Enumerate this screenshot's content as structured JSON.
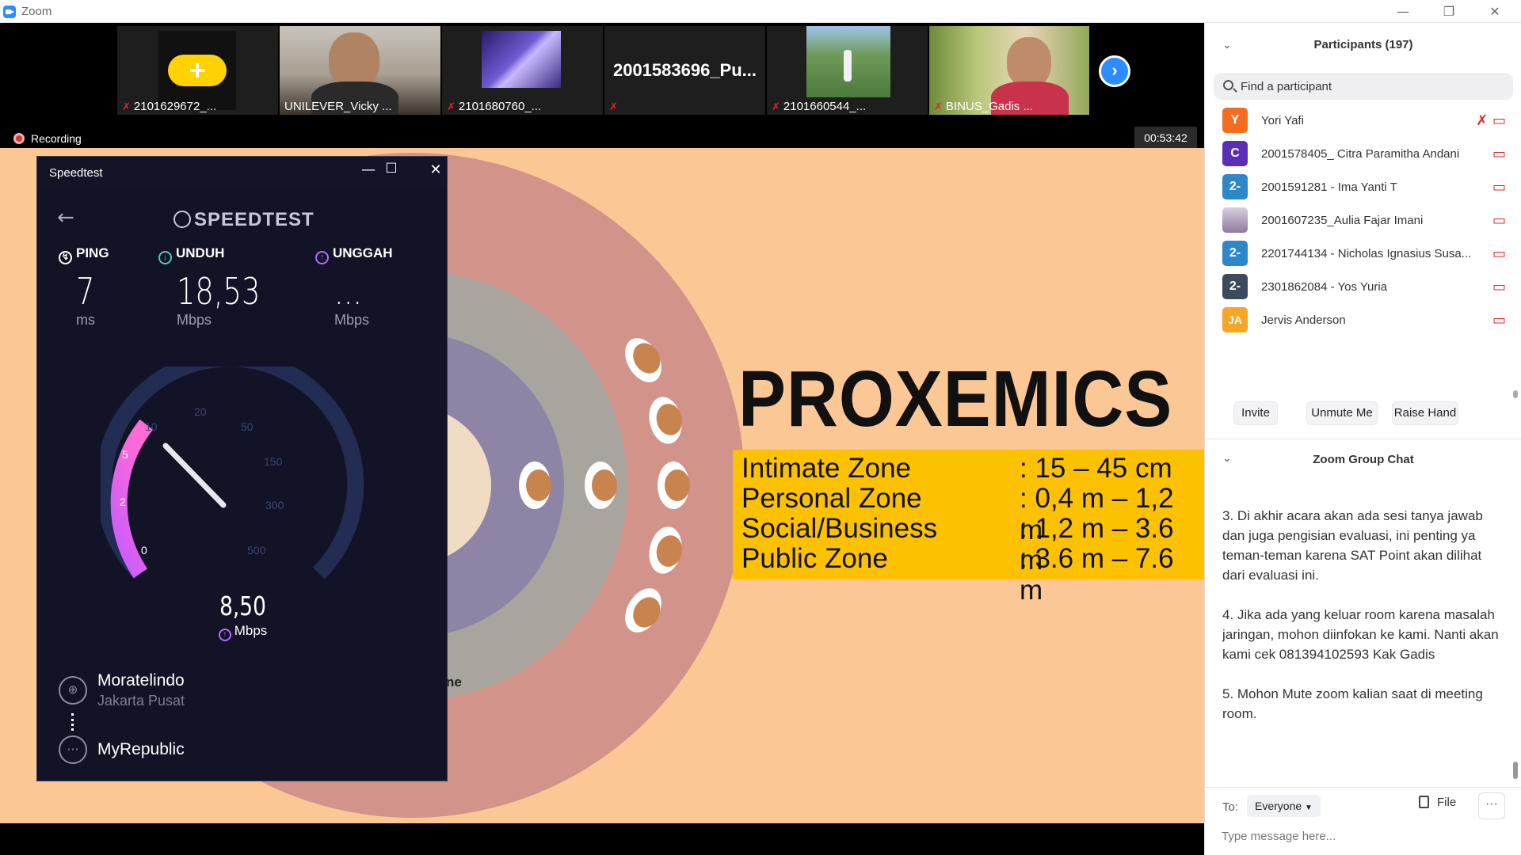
{
  "window": {
    "title": "Zoom",
    "min": "—",
    "restore": "❐",
    "close": "✕"
  },
  "thumbnails": [
    {
      "name": "2101629672_...",
      "muted": true,
      "avatar": "yellow-plus"
    },
    {
      "name": "UNILEVER_Vicky ...",
      "muted": false,
      "avatar": "video"
    },
    {
      "name": "2101680760_...",
      "muted": true,
      "avatar": "video"
    },
    {
      "name": "2001583696_Pu...",
      "muted": true,
      "avatar": "name"
    },
    {
      "name": "2101660544_...",
      "muted": true,
      "avatar": "video"
    },
    {
      "name": "BINUS_Gadis ...",
      "muted": true,
      "avatar": "video"
    }
  ],
  "recording": {
    "label": "Recording"
  },
  "timer": "00:53:42",
  "slide": {
    "title": "PROXEMICS",
    "zones": [
      {
        "label": "Intimate Zone",
        "value": ": 15 – 45 cm"
      },
      {
        "label": "Personal Zone",
        "value": ": 0,4 m – 1,2 m"
      },
      {
        "label": "Social/Business",
        "value": ": 1,2 m – 3.6 m"
      },
      {
        "label": "Public Zone",
        "value": ": 3.6 m – 7.6 m"
      }
    ],
    "partial_label": "ne",
    "colors": {
      "background": "#fbc895",
      "box": "#fcc100"
    }
  },
  "speedtest": {
    "window_title": "Speedtest",
    "logo": "SPEEDTEST",
    "ping": {
      "label": "PING",
      "value": "7",
      "unit": "ms"
    },
    "download": {
      "label": "UNDUH",
      "value": "18,53",
      "unit": "Mbps"
    },
    "upload": {
      "label": "UNGGAH",
      "value": "...",
      "unit": "Mbps"
    },
    "gauge": {
      "ticks": [
        "0",
        "2",
        "5",
        "10",
        "20",
        "50",
        "150",
        "300",
        "500"
      ],
      "live_value": "8,50",
      "live_unit": "Mbps"
    },
    "server": {
      "name": "Moratelindo",
      "location": "Jakarta Pusat"
    },
    "isp": "MyRepublic"
  },
  "participants": {
    "header": "Participants (197)",
    "search_placeholder": "Find a participant",
    "list": [
      {
        "initial": "Y",
        "name": "Yori Yafi",
        "color": "#f26d21",
        "mic_muted": true
      },
      {
        "initial": "C",
        "name": "2001578405_ Citra Paramitha Andani",
        "color": "#5b2fb5",
        "mic_muted": false
      },
      {
        "initial": "2-",
        "name": "2001591281 - Ima Yanti T",
        "color": "#2e87c9",
        "mic_muted": false
      },
      {
        "initial": "",
        "name": "2001607235_Aulia Fajar Imani",
        "color": "#b9a7c6",
        "mic_muted": false
      },
      {
        "initial": "2-",
        "name": "2201744134 - Nicholas Ignasius Susa...",
        "color": "#2e87c9",
        "mic_muted": false
      },
      {
        "initial": "2-",
        "name": "2301862084 - Yos Yuria",
        "color": "#3b4a5c",
        "mic_muted": false
      },
      {
        "initial": "JA",
        "name": "Jervis Anderson",
        "color": "#f5a623",
        "mic_muted": false
      }
    ],
    "buttons": {
      "invite": "Invite",
      "unmute": "Unmute Me",
      "raise": "Raise Hand"
    }
  },
  "chat": {
    "header": "Zoom Group Chat",
    "messages": [
      "3. Di akhir acara akan ada sesi tanya jawab dan juga pengisian evaluasi, ini penting ya teman-teman karena SAT Point akan dilihat dari evaluasi ini.",
      "4. Jika ada yang keluar room karena masalah jaringan, mohon diinfokan ke kami. Nanti akan kami cek 081394102593 Kak Gadis",
      "5. Mohon Mute zoom kalian saat di meeting room."
    ],
    "to_label": "To:",
    "to_value": "Everyone",
    "file_label": "File",
    "more_label": "···",
    "input_placeholder": "Type message here..."
  }
}
